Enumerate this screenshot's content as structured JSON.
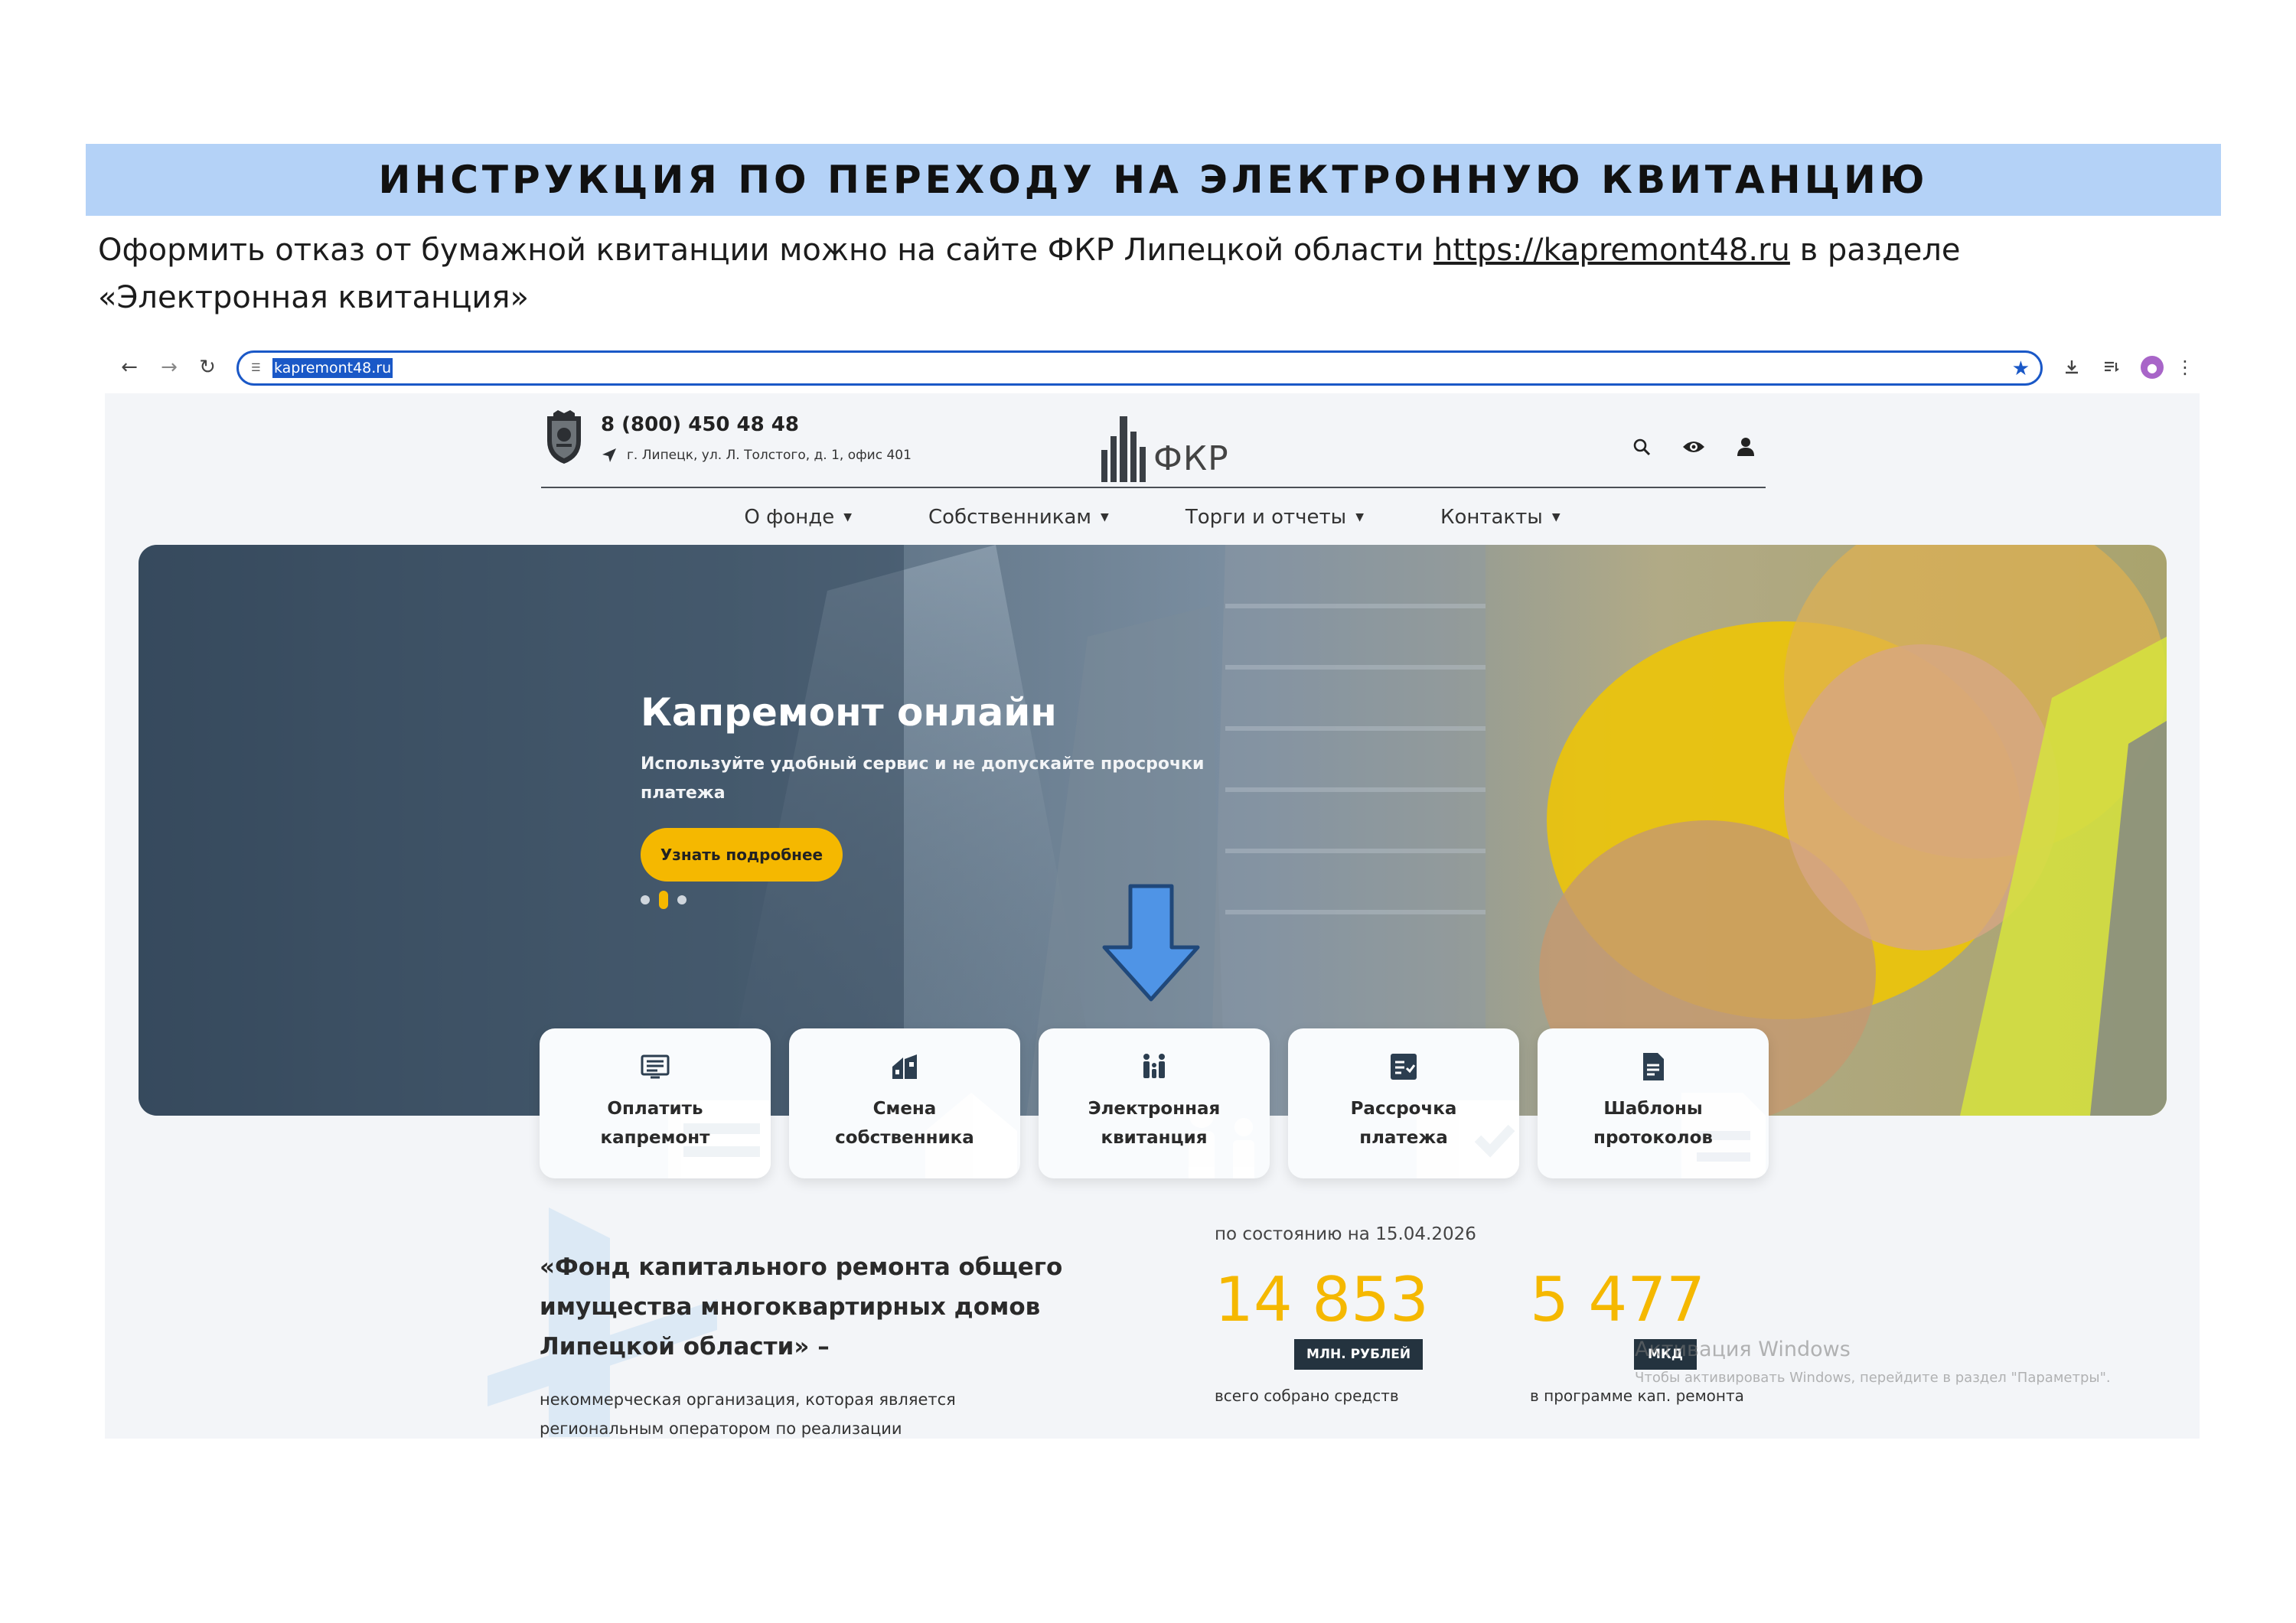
{
  "doc": {
    "title": "ИНСТРУКЦИЯ ПО ПЕРЕХОДУ НА ЭЛЕКТРОННУЮ КВИТАНЦИЮ",
    "intro_before": "Оформить отказ от бумажной квитанции можно на сайте ФКР Липецкой области ",
    "intro_link": "https://kapremont48.ru",
    "intro_after": " в разделе «Электронная квитанция»",
    "title_band_color": "#b4d2f7"
  },
  "browser": {
    "url": "kapremont48.ru",
    "icons": [
      "back-icon",
      "forward-icon",
      "reload-icon",
      "site-settings-icon",
      "bookmark-star-icon",
      "download-icon",
      "reading-list-icon",
      "profile-avatar-icon",
      "more-menu-icon"
    ],
    "accent_color": "#1a58c7"
  },
  "site": {
    "phone": "8 (800) 450 48 48",
    "address": "г. Липецк, ул. Л. Толстого, д. 1, офис 401",
    "logo_text": "ФКР",
    "header_icons": [
      "search-icon",
      "eye-icon",
      "user-icon"
    ],
    "menu": [
      {
        "label": "О фонде"
      },
      {
        "label": "Собственникам"
      },
      {
        "label": "Торги и отчеты"
      },
      {
        "label": "Контакты"
      }
    ],
    "hero": {
      "title": "Капремонт онлайн",
      "subtitle": "Используйте удобный сервис и не допускайте просрочки платежа",
      "button": "Узнать подробнее",
      "slides_total": 3,
      "active_slide": 2
    },
    "tiles": [
      {
        "label_line1": "Оплатить",
        "label_line2": "капремонт",
        "icon": "invoice-icon"
      },
      {
        "label_line1": "Смена",
        "label_line2": "собственника",
        "icon": "house-swap-icon"
      },
      {
        "label_line1": "Электронная",
        "label_line2": "квитанция",
        "icon": "family-icon"
      },
      {
        "label_line1": "Рассрочка",
        "label_line2": "платежа",
        "icon": "checklist-icon"
      },
      {
        "label_line1": "Шаблоны",
        "label_line2": "протоколов",
        "icon": "document-icon"
      }
    ],
    "about": {
      "title": "«Фонд капитального ремонта общего имущества многоквартирных домов Липецкой области» –",
      "text": "некоммерческая организация, которая является региональным оператором по реализации"
    },
    "stats": {
      "as_of": "по состоянию на 15.04.2026",
      "items": [
        {
          "value": "14 853",
          "badge": "МЛН. РУБЛЕЙ",
          "caption": "всего собрано средств"
        },
        {
          "value": "5 477",
          "badge": "МКД",
          "caption": "в программе кап. ремонта"
        }
      ],
      "accent_color": "#f5b800"
    },
    "watermark": {
      "line1": "Активация Windows",
      "line2": "Чтобы активировать Windows, перейдите в раздел \"Параметры\"."
    }
  }
}
